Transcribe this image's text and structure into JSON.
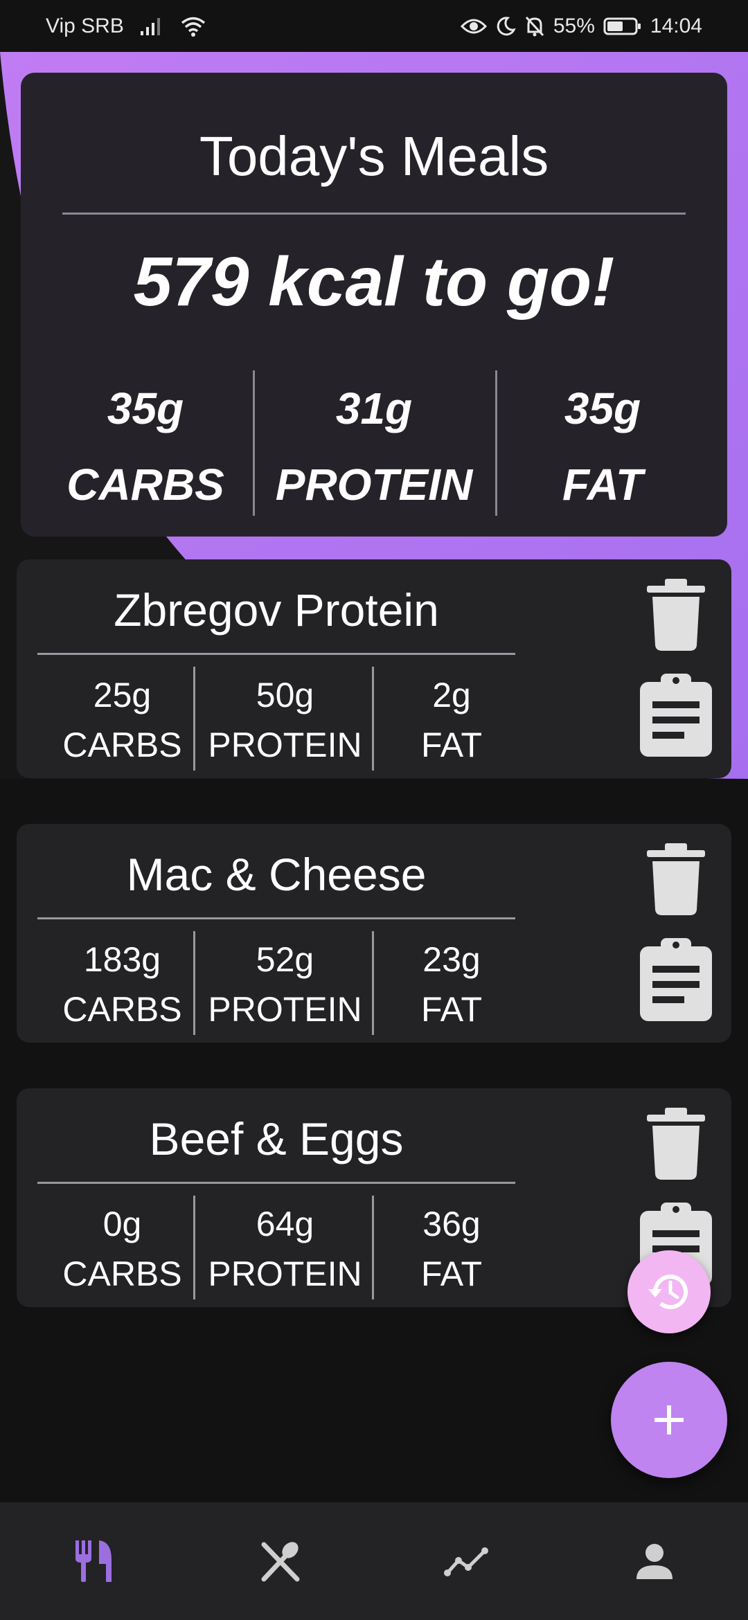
{
  "status_bar": {
    "carrier": "Vip SRB",
    "battery": "55%",
    "time": "14:04"
  },
  "summary": {
    "title": "Today's Meals",
    "remaining": "579 kcal to go!",
    "macros": [
      {
        "value": "35g",
        "label": "CARBS"
      },
      {
        "value": "31g",
        "label": "PROTEIN"
      },
      {
        "value": "35g",
        "label": "FAT"
      }
    ]
  },
  "meals": [
    {
      "name": "Zbregov Protein",
      "macros": [
        {
          "value": "25g",
          "label": "CARBS"
        },
        {
          "value": "50g",
          "label": "PROTEIN"
        },
        {
          "value": "2g",
          "label": "FAT"
        }
      ]
    },
    {
      "name": "Mac & Cheese",
      "macros": [
        {
          "value": "183g",
          "label": "CARBS"
        },
        {
          "value": "52g",
          "label": "PROTEIN"
        },
        {
          "value": "23g",
          "label": "FAT"
        }
      ]
    },
    {
      "name": "Beef & Eggs",
      "macros": [
        {
          "value": "0g",
          "label": "CARBS"
        },
        {
          "value": "64g",
          "label": "PROTEIN"
        },
        {
          "value": "36g",
          "label": "FAT"
        }
      ]
    }
  ],
  "colors": {
    "accent": "#bf84f0",
    "history_fab": "#f2b6f2",
    "card": "#252329",
    "background": "#121212",
    "nav_active": "#9b6fe0",
    "nav_inactive": "#cfcfcf"
  },
  "nav": {
    "items": [
      "meals-icon",
      "food-icon",
      "progress-icon",
      "profile-icon"
    ],
    "active": "meals-icon"
  }
}
